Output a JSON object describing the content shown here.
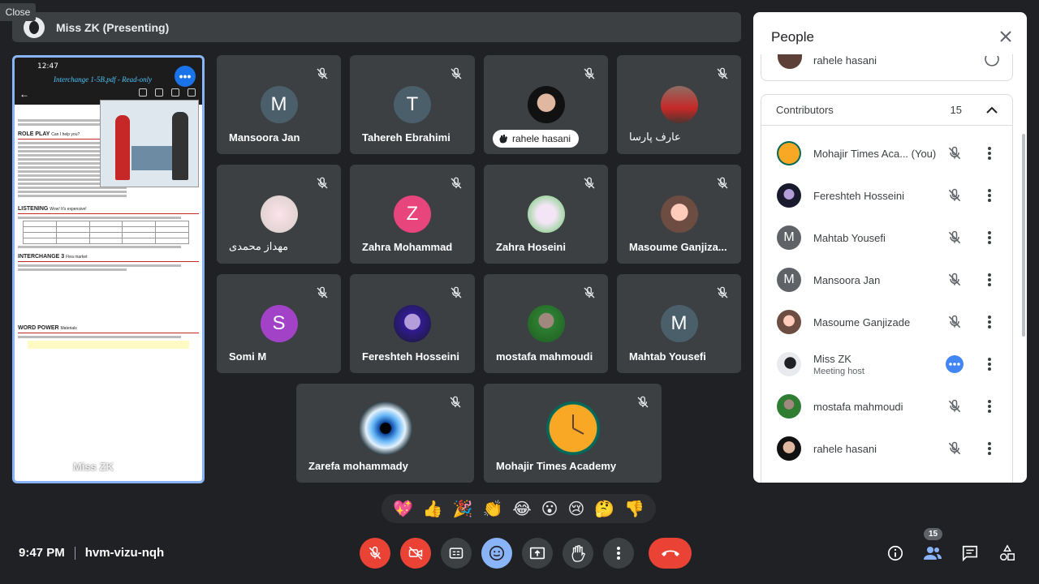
{
  "close_label": "Close",
  "presenting": {
    "name": "Miss ZK (Presenting)"
  },
  "slide": {
    "status_time": "12:47",
    "file_name": "Interchange 1-5B.pdf - Read-only",
    "sections": [
      "ROLE PLAY",
      "LISTENING",
      "INTERCHANGE 3",
      "WORD POWER"
    ],
    "section_subs": [
      "Can I help you?",
      "Wow! It's expensive!",
      "Flea market",
      "Materials"
    ],
    "overlay_name": "Miss ZK"
  },
  "tiles": [
    {
      "name": "Mansoora Jan",
      "initial": "M"
    },
    {
      "name": "Tahereh Ebrahimi",
      "initial": "T"
    },
    {
      "name": "rahele hasani"
    },
    {
      "name": "عارف پارسا"
    },
    {
      "name": "مهداز محمدی"
    },
    {
      "name": "Zahra Mohammad",
      "initial": "Z"
    },
    {
      "name": "Zahra Hoseini"
    },
    {
      "name": "Masoume Ganjiza..."
    },
    {
      "name": "Somi M",
      "initial": "S"
    },
    {
      "name": "Fereshteh Hosseini"
    },
    {
      "name": "mostafa mahmoudi"
    },
    {
      "name": "Mahtab Yousefi",
      "initial": "M"
    },
    {
      "name": "Zarefa mohammady"
    },
    {
      "name": "Mohajir Times Academy"
    }
  ],
  "reactions": [
    "💖",
    "👍",
    "🎉",
    "👏",
    "😂",
    "😮",
    "😢",
    "🤔",
    "👎"
  ],
  "meeting": {
    "time": "9:47 PM",
    "code": "hvm-vizu-nqh"
  },
  "people_badge": "15",
  "panel": {
    "title": "People",
    "prev_person": "rahele hasani",
    "group_title": "Contributors",
    "group_count": "15",
    "people": [
      {
        "name": "Mohajir Times Aca...  (You)"
      },
      {
        "name": "Fereshteh Hosseini"
      },
      {
        "name": "Mahtab Yousefi",
        "initial": "M"
      },
      {
        "name": "Mansoora Jan",
        "initial": "M"
      },
      {
        "name": "Masoume Ganjizade"
      },
      {
        "name": "Miss ZK",
        "sub": "Meeting host"
      },
      {
        "name": "mostafa mahmoudi"
      },
      {
        "name": "rahele hasani"
      }
    ]
  },
  "colors": {
    "background": "#202124",
    "tile": "#3c4043",
    "accent_blue": "#8ab4f8",
    "danger_red": "#ea4335",
    "avatar_slate": "#4a5f6a",
    "avatar_pink": "#e8457c",
    "avatar_purple": "#a142c7",
    "avatar_grey": "#5f6368"
  },
  "icons": {
    "tile_mic": "mic-off-icon",
    "controls": [
      "mic-off-icon",
      "camera-off-icon",
      "captions-icon",
      "emoji-icon",
      "present-screen-icon",
      "raise-hand-icon",
      "more-vert-icon",
      "call-end-icon"
    ],
    "right": [
      "info-icon",
      "people-icon",
      "chat-icon",
      "activities-icon"
    ]
  }
}
